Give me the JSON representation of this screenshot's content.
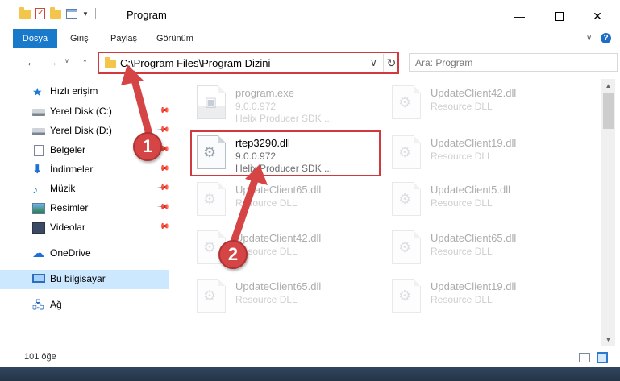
{
  "window": {
    "title": "Program",
    "minimize_glyph": "—",
    "close_glyph": "✕"
  },
  "ribbon": {
    "tabs": [
      {
        "label": "Dosya"
      },
      {
        "label": "Giriş"
      },
      {
        "label": "Paylaş"
      },
      {
        "label": "Görünüm"
      }
    ],
    "help_glyph": "?"
  },
  "navigation": {
    "back_glyph": "←",
    "forward_glyph": "→",
    "up_glyph": "↑",
    "address": "C:\\Program Files\\Program Dizini",
    "search_placeholder": "Ara: Program"
  },
  "sidebar": {
    "items": [
      {
        "label": "Hızlı erişim",
        "icon": "star-icon"
      },
      {
        "label": "Yerel Disk (C:)",
        "icon": "disk-icon",
        "pinned": true
      },
      {
        "label": "Yerel Disk (D:)",
        "icon": "disk-icon",
        "pinned": true
      },
      {
        "label": "Belgeler",
        "icon": "documents-icon",
        "pinned": true
      },
      {
        "label": "İndirmeler",
        "icon": "download-icon",
        "pinned": true
      },
      {
        "label": "Müzik",
        "icon": "music-icon",
        "pinned": true
      },
      {
        "label": "Resimler",
        "icon": "pictures-icon",
        "pinned": true
      },
      {
        "label": "Videolar",
        "icon": "videos-icon",
        "pinned": true
      },
      {
        "label": "OneDrive",
        "icon": "cloud-icon"
      },
      {
        "label": "Bu bilgisayar",
        "icon": "computer-icon",
        "selected": true
      },
      {
        "label": "Ağ",
        "icon": "network-icon"
      }
    ]
  },
  "files": [
    {
      "name": "program.exe",
      "line2": "9.0.0.972",
      "line3": "Helix Producer SDK ...",
      "icon": "exe-file-icon",
      "faded": true
    },
    {
      "name": "UpdateClient42.dll",
      "line2": "Resource DLL",
      "line3": "",
      "icon": "dll-file-icon",
      "faded": true
    },
    {
      "name": "rtep3290.dll",
      "line2": "9.0.0.972",
      "line3": "Helix Producer SDK ...",
      "icon": "dll-file-icon",
      "faded": false
    },
    {
      "name": "UpdateClient19.dll",
      "line2": "Resource DLL",
      "line3": "",
      "icon": "dll-file-icon",
      "faded": true
    },
    {
      "name": "UpdateClient65.dll",
      "line2": "Resource DLL",
      "line3": "",
      "icon": "dll-file-icon",
      "faded": true
    },
    {
      "name": "UpdateClient5.dll",
      "line2": "Resource DLL",
      "line3": "",
      "icon": "dll-file-icon",
      "faded": true
    },
    {
      "name": "UpdateClient42.dll",
      "line2": "Resource DLL",
      "line3": "",
      "icon": "dll-file-icon",
      "faded": true
    },
    {
      "name": "UpdateClient65.dll",
      "line2": "Resource DLL",
      "line3": "",
      "icon": "dll-file-icon",
      "faded": true
    },
    {
      "name": "UpdateClient65.dll",
      "line2": "Resource DLL",
      "line3": "",
      "icon": "dll-file-icon",
      "faded": true
    },
    {
      "name": "UpdateClient19.dll",
      "line2": "Resource DLL",
      "line3": "",
      "icon": "dll-file-icon",
      "faded": true
    }
  ],
  "status": {
    "item_count": "101 öğe"
  },
  "annotations": {
    "step1": "1",
    "step2": "2",
    "color": "#d64545"
  }
}
